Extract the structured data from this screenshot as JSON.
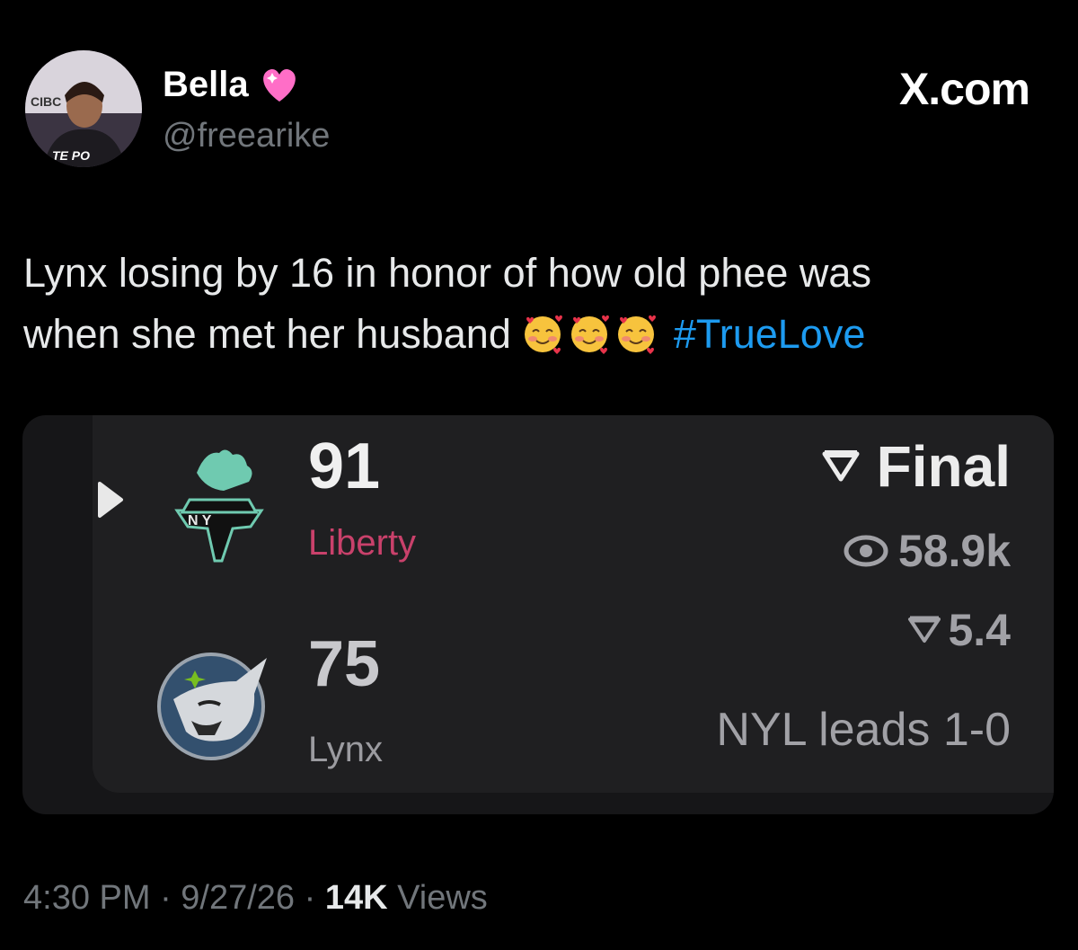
{
  "post": {
    "author_name": "Bella",
    "author_handle": "@freearike",
    "brand": "X.com",
    "text_line1": "Lynx losing by 16 in honor of how old phee was",
    "text_line2": "when she met her husband",
    "hashtag": "#TrueLove",
    "timestamp": "4:30 PM · 9/27/26 · ",
    "views_count": "14K",
    "views_label": " Views",
    "avatar_text_top": "CIBC",
    "avatar_text_bottom": "TE  PO"
  },
  "scorecard": {
    "home": {
      "score": "91",
      "team": "Liberty",
      "color": "#c9416b",
      "logo_text": "N  Y"
    },
    "away": {
      "score": "75",
      "team": "Lynx",
      "color": "#9b9ba0"
    },
    "status": "Final",
    "views": "58.9k",
    "odds": "5.4",
    "series": "NYL leads 1-0"
  },
  "colors": {
    "hashtag": "#1d9bf0",
    "background": "#000000",
    "card": "#1f1f21"
  }
}
